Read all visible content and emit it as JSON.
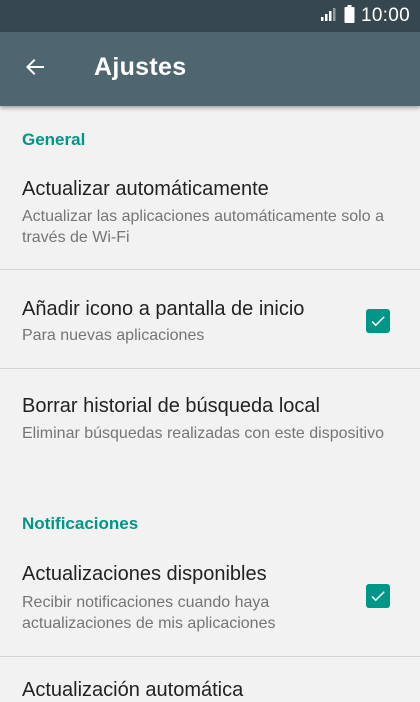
{
  "status_bar": {
    "time": "10:00",
    "icons": [
      "signal-icon",
      "battery-icon"
    ]
  },
  "app_bar": {
    "title": "Ajustes",
    "back_icon": "arrow-back-icon"
  },
  "sections": [
    {
      "header": "General",
      "items": [
        {
          "title": "Actualizar automáticamente",
          "subtitle": "Actualizar las aplicaciones automáticamente solo a través de Wi-Fi",
          "checkbox": null
        },
        {
          "title": "Añadir icono a pantalla de inicio",
          "subtitle": "Para nuevas aplicaciones",
          "checkbox": true
        },
        {
          "title": "Borrar historial de búsqueda local",
          "subtitle": "Eliminar búsquedas realizadas con este dispositivo",
          "checkbox": null
        }
      ]
    },
    {
      "header": "Notificaciones",
      "items": [
        {
          "title": "Actualizaciones disponibles",
          "subtitle": "Recibir notificaciones cuando haya actualizaciones de mis aplicaciones",
          "checkbox": true
        },
        {
          "title": "Actualización automática",
          "subtitle": "",
          "checkbox": null
        }
      ]
    }
  ],
  "colors": {
    "status_bar": "#37474f",
    "app_bar": "#4f6670",
    "accent": "#009688",
    "background": "#f2f2f2"
  }
}
